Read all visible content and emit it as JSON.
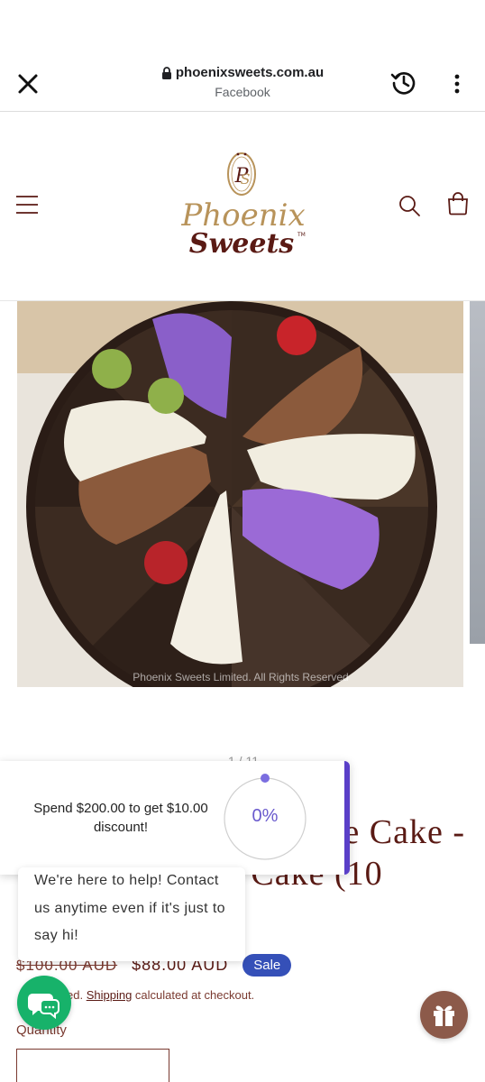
{
  "browser": {
    "url": "phoenixsweets.com.au",
    "source": "Facebook"
  },
  "logo": {
    "line1": "Phoenix",
    "line2": "Sweets",
    "tm": "TM",
    "colors": {
      "gold": "#b8935a",
      "burgundy": "#5a1a14"
    }
  },
  "icons": {
    "close": "close-icon",
    "lock": "lock-icon",
    "history": "history-icon",
    "more": "more-vert-icon",
    "menu": "hamburger-menu-icon",
    "search": "search-icon",
    "cart": "cart-icon",
    "chat": "chat-icon",
    "gift": "gift-icon"
  },
  "gallery": {
    "watermark": "Phoenix Sweets Limited. All Rights Reserved",
    "counter": "1 / 11"
  },
  "product": {
    "title_line1": "e Cake -",
    "title_line2": "e Cake (10",
    "price_old": "$100.00 AUD",
    "price_new": "$88.00 AUD",
    "sale_label": "Sale",
    "tax_prefix": "ed.",
    "shipping_link": "Shipping",
    "tax_suffix": " calculated at checkout.",
    "quantity_label": "Quantity"
  },
  "discount_popup": {
    "text": "Spend $200.00 to get $10.00 discount!",
    "progress_label": "0%",
    "progress_value": 0,
    "accent_color": "#5a3fc8"
  },
  "chat": {
    "message": "We're here to help! Contact us anytime even if it's just to say hi!",
    "button_color": "#17b26a"
  },
  "colors": {
    "sale_badge": "#3550b8",
    "title": "#5a1a14",
    "gift_button": "#8c5a4a"
  }
}
